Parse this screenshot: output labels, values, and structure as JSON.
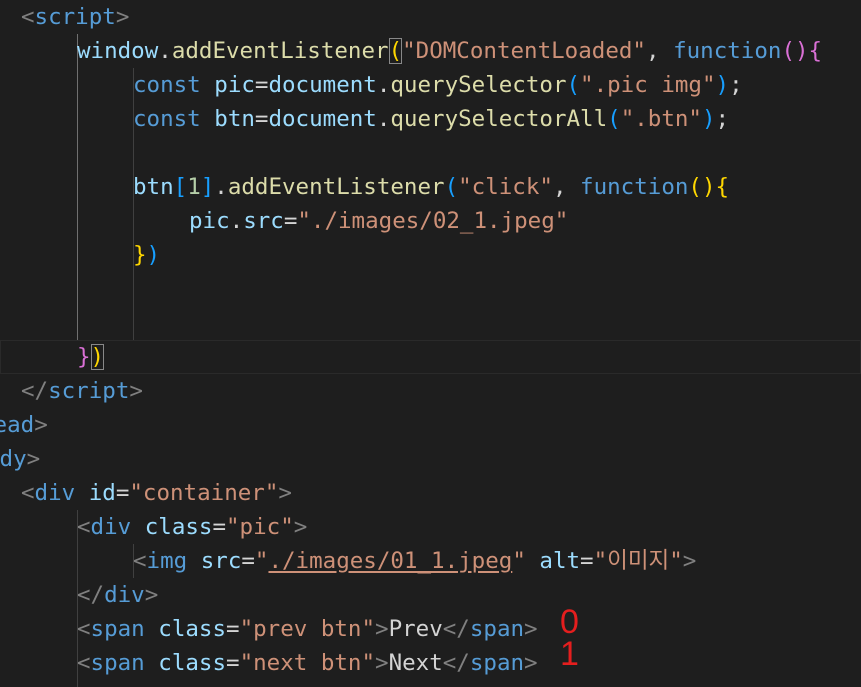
{
  "editor": {
    "lines": [
      {
        "row": 0,
        "indent": 21,
        "tokens": [
          {
            "t": "<",
            "c": "punct"
          },
          {
            "t": "script",
            "c": "tag"
          },
          {
            "t": ">",
            "c": "punct"
          }
        ]
      },
      {
        "row": 1,
        "indent": 77,
        "tokens": [
          {
            "t": "window",
            "c": "var"
          },
          {
            "t": ".",
            "c": "text"
          },
          {
            "t": "addEventListener",
            "c": "fn"
          },
          {
            "t": "(",
            "c": "b1",
            "bm": true
          },
          {
            "t": "\"DOMContentLoaded\"",
            "c": "str"
          },
          {
            "t": ", ",
            "c": "text"
          },
          {
            "t": "function",
            "c": "kw"
          },
          {
            "t": "()",
            "c": "b2"
          },
          {
            "t": "{",
            "c": "b2"
          }
        ]
      },
      {
        "row": 2,
        "indent": 133,
        "tokens": [
          {
            "t": "const",
            "c": "kw"
          },
          {
            "t": " ",
            "c": "text"
          },
          {
            "t": "pic",
            "c": "var"
          },
          {
            "t": "=",
            "c": "text"
          },
          {
            "t": "document",
            "c": "var"
          },
          {
            "t": ".",
            "c": "text"
          },
          {
            "t": "querySelector",
            "c": "fn"
          },
          {
            "t": "(",
            "c": "b3"
          },
          {
            "t": "\".pic img\"",
            "c": "str"
          },
          {
            "t": ")",
            "c": "b3"
          },
          {
            "t": ";",
            "c": "text"
          }
        ]
      },
      {
        "row": 3,
        "indent": 133,
        "tokens": [
          {
            "t": "const",
            "c": "kw"
          },
          {
            "t": " ",
            "c": "text"
          },
          {
            "t": "btn",
            "c": "var"
          },
          {
            "t": "=",
            "c": "text"
          },
          {
            "t": "document",
            "c": "var"
          },
          {
            "t": ".",
            "c": "text"
          },
          {
            "t": "querySelectorAll",
            "c": "fn"
          },
          {
            "t": "(",
            "c": "b3"
          },
          {
            "t": "\".btn\"",
            "c": "str"
          },
          {
            "t": ")",
            "c": "b3"
          },
          {
            "t": ";",
            "c": "text"
          }
        ]
      },
      {
        "row": 4,
        "indent": 133,
        "tokens": []
      },
      {
        "row": 5,
        "indent": 133,
        "tokens": [
          {
            "t": "btn",
            "c": "var"
          },
          {
            "t": "[",
            "c": "b3"
          },
          {
            "t": "1",
            "c": "num"
          },
          {
            "t": "]",
            "c": "b3"
          },
          {
            "t": ".",
            "c": "text"
          },
          {
            "t": "addEventListener",
            "c": "fn"
          },
          {
            "t": "(",
            "c": "b3"
          },
          {
            "t": "\"click\"",
            "c": "str"
          },
          {
            "t": ", ",
            "c": "text"
          },
          {
            "t": "function",
            "c": "kw"
          },
          {
            "t": "()",
            "c": "b1"
          },
          {
            "t": "{",
            "c": "b1"
          }
        ]
      },
      {
        "row": 6,
        "indent": 189,
        "tokens": [
          {
            "t": "pic",
            "c": "var"
          },
          {
            "t": ".",
            "c": "text"
          },
          {
            "t": "src",
            "c": "var"
          },
          {
            "t": "=",
            "c": "text"
          },
          {
            "t": "\"./images/02_1.jpeg\"",
            "c": "str"
          }
        ]
      },
      {
        "row": 7,
        "indent": 133,
        "tokens": [
          {
            "t": "}",
            "c": "b1"
          },
          {
            "t": ")",
            "c": "b3"
          }
        ]
      },
      {
        "row": 8,
        "indent": 133,
        "tokens": []
      },
      {
        "row": 9,
        "indent": 133,
        "tokens": []
      },
      {
        "row": 10,
        "indent": 77,
        "current": true,
        "tokens": [
          {
            "t": "}",
            "c": "b2"
          },
          {
            "t": ")",
            "c": "b1",
            "bm": true
          }
        ]
      },
      {
        "row": 11,
        "indent": 21,
        "tokens": [
          {
            "t": "</",
            "c": "punct"
          },
          {
            "t": "script",
            "c": "tag"
          },
          {
            "t": ">",
            "c": "punct"
          }
        ]
      },
      {
        "row": 12,
        "indent": -20,
        "tokens": [
          {
            "t": "head",
            "c": "tag"
          },
          {
            "t": ">",
            "c": "punct"
          }
        ]
      },
      {
        "row": 13,
        "indent": -14,
        "tokens": [
          {
            "t": "ody",
            "c": "tag"
          },
          {
            "t": ">",
            "c": "punct"
          }
        ]
      },
      {
        "row": 14,
        "indent": 21,
        "tokens": [
          {
            "t": "<",
            "c": "punct"
          },
          {
            "t": "div",
            "c": "tag"
          },
          {
            "t": " ",
            "c": "text"
          },
          {
            "t": "id",
            "c": "attr"
          },
          {
            "t": "=",
            "c": "text"
          },
          {
            "t": "\"container\"",
            "c": "str"
          },
          {
            "t": ">",
            "c": "punct"
          }
        ]
      },
      {
        "row": 15,
        "indent": 77,
        "tokens": [
          {
            "t": "<",
            "c": "punct"
          },
          {
            "t": "div",
            "c": "tag"
          },
          {
            "t": " ",
            "c": "text"
          },
          {
            "t": "class",
            "c": "attr"
          },
          {
            "t": "=",
            "c": "text"
          },
          {
            "t": "\"pic\"",
            "c": "str"
          },
          {
            "t": ">",
            "c": "punct"
          }
        ]
      },
      {
        "row": 16,
        "indent": 133,
        "tokens": [
          {
            "t": "<",
            "c": "punct"
          },
          {
            "t": "img",
            "c": "tag"
          },
          {
            "t": " ",
            "c": "text"
          },
          {
            "t": "src",
            "c": "attr"
          },
          {
            "t": "=",
            "c": "text"
          },
          {
            "t": "\"",
            "c": "str"
          },
          {
            "t": "./images/01_1.jpeg",
            "c": "str",
            "link": true
          },
          {
            "t": "\"",
            "c": "str"
          },
          {
            "t": " ",
            "c": "text"
          },
          {
            "t": "alt",
            "c": "attr"
          },
          {
            "t": "=",
            "c": "text"
          },
          {
            "t": "\"이미지\"",
            "c": "str"
          },
          {
            "t": ">",
            "c": "punct"
          }
        ]
      },
      {
        "row": 17,
        "indent": 77,
        "tokens": [
          {
            "t": "</",
            "c": "punct"
          },
          {
            "t": "div",
            "c": "tag"
          },
          {
            "t": ">",
            "c": "punct"
          }
        ]
      },
      {
        "row": 18,
        "indent": 77,
        "tokens": [
          {
            "t": "<",
            "c": "punct"
          },
          {
            "t": "span",
            "c": "tag"
          },
          {
            "t": " ",
            "c": "text"
          },
          {
            "t": "class",
            "c": "attr"
          },
          {
            "t": "=",
            "c": "text"
          },
          {
            "t": "\"prev btn\"",
            "c": "str"
          },
          {
            "t": ">",
            "c": "punct"
          },
          {
            "t": "Prev",
            "c": "text"
          },
          {
            "t": "</",
            "c": "punct"
          },
          {
            "t": "span",
            "c": "tag"
          },
          {
            "t": ">",
            "c": "punct"
          }
        ]
      },
      {
        "row": 19,
        "indent": 77,
        "tokens": [
          {
            "t": "<",
            "c": "punct"
          },
          {
            "t": "span",
            "c": "tag"
          },
          {
            "t": " ",
            "c": "text"
          },
          {
            "t": "class",
            "c": "attr"
          },
          {
            "t": "=",
            "c": "text"
          },
          {
            "t": "\"next btn\"",
            "c": "str"
          },
          {
            "t": ">",
            "c": "punct"
          },
          {
            "t": "Next",
            "c": "text"
          },
          {
            "t": "</",
            "c": "punct"
          },
          {
            "t": "span",
            "c": "tag"
          },
          {
            "t": ">",
            "c": "punct"
          }
        ]
      }
    ]
  },
  "annotations": {
    "prev_index": "0",
    "next_index": "1"
  },
  "colors": {
    "background": "#1e1e1e",
    "keyword": "#569cd6",
    "string": "#ce9178",
    "function": "#dcdcaa",
    "variable": "#9cdcfe",
    "number": "#b5cea8",
    "bracket_gold": "#ffd700",
    "bracket_orchid": "#da70d6",
    "bracket_blue": "#179fff",
    "annotation_red": "#e51e1e"
  }
}
